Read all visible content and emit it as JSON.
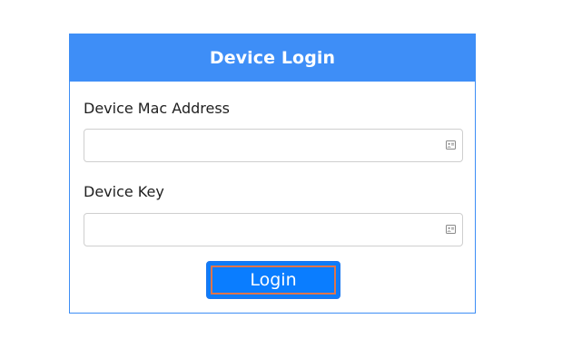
{
  "card": {
    "title": "Device Login"
  },
  "form": {
    "mac_label": "Device Mac Address",
    "mac_value": "",
    "mac_placeholder": "",
    "key_label": "Device Key",
    "key_value": "",
    "key_placeholder": "",
    "autofill_icon": "contact-card-icon"
  },
  "actions": {
    "login_label": "Login"
  },
  "colors": {
    "header_bg": "#3e8ef7",
    "button_bg": "#0a7dff",
    "focus_outline": "#e0744a",
    "card_border": "#3d8ef5"
  }
}
